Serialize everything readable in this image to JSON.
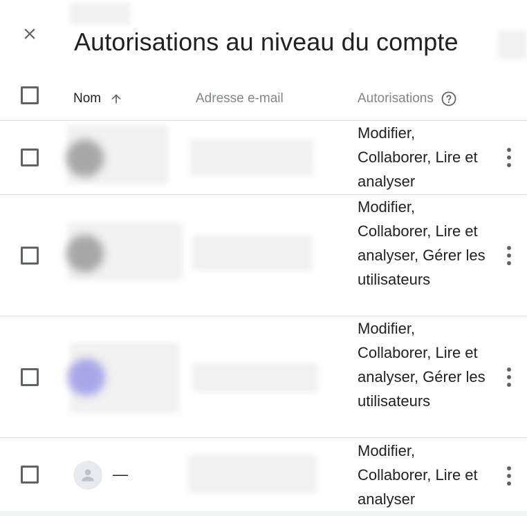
{
  "dialog": {
    "title": "Autorisations au niveau du compte"
  },
  "table": {
    "columns": {
      "name": "Nom",
      "email": "Adresse e-mail",
      "permissions": "Autorisations"
    },
    "rows": [
      {
        "permissions": "Modifier, Collaborer, Lire et analyser",
        "name": "",
        "email": ""
      },
      {
        "permissions": "Modifier, Collaborer, Lire et analyser, Gérer les utilisateurs",
        "name": "",
        "email": ""
      },
      {
        "permissions": "Modifier, Collaborer, Lire et analyser, Gérer les utilisateurs",
        "name": "",
        "email": ""
      },
      {
        "permissions": "Modifier, Collaborer, Lire et analyser",
        "name": "—",
        "email": ""
      }
    ]
  },
  "icons": {
    "close": "close-icon",
    "sort": "arrow-up-icon",
    "help": "help-circle-icon",
    "more": "more-vert-icon",
    "avatar": "person-icon"
  },
  "colors": {
    "text": "#202124",
    "muted": "#80868b",
    "icon": "#5f6368",
    "divider": "#dadce0",
    "avatar_accent": "#a9a6e8"
  }
}
